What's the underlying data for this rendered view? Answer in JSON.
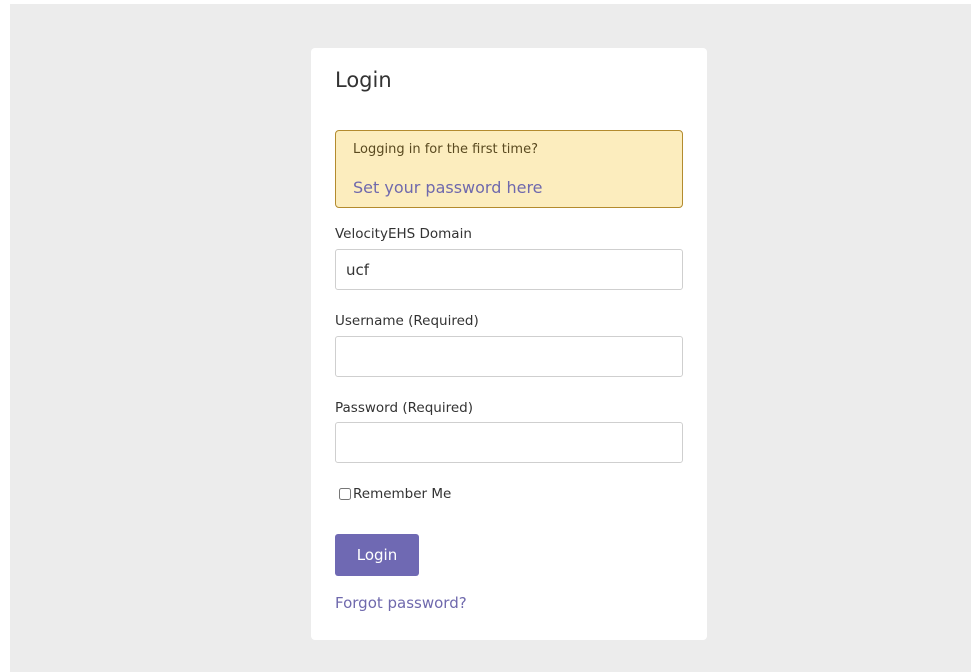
{
  "login": {
    "title": "Login",
    "alert": {
      "text": "Logging in for the first time?",
      "link": "Set your password here"
    },
    "domain": {
      "label": "VelocityEHS Domain",
      "value": "ucf"
    },
    "username": {
      "label": "Username (Required)",
      "value": ""
    },
    "password": {
      "label": "Password (Required)",
      "value": ""
    },
    "remember_label": "Remember Me",
    "remember_checked": false,
    "login_button": "Login",
    "forgot_link": "Forgot password?"
  },
  "colors": {
    "page_background": "#ececec",
    "accent": "#6f69b3",
    "alert_background": "#fcedbe",
    "alert_border": "#b38b2e"
  }
}
